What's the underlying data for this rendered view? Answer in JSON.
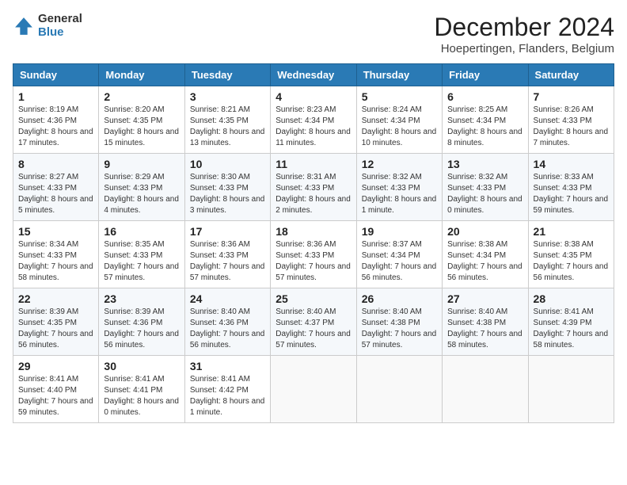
{
  "logo": {
    "general": "General",
    "blue": "Blue"
  },
  "title": "December 2024",
  "location": "Hoepertingen, Flanders, Belgium",
  "days_of_week": [
    "Sunday",
    "Monday",
    "Tuesday",
    "Wednesday",
    "Thursday",
    "Friday",
    "Saturday"
  ],
  "weeks": [
    [
      {
        "day": "1",
        "sunrise": "Sunrise: 8:19 AM",
        "sunset": "Sunset: 4:36 PM",
        "daylight": "Daylight: 8 hours and 17 minutes."
      },
      {
        "day": "2",
        "sunrise": "Sunrise: 8:20 AM",
        "sunset": "Sunset: 4:35 PM",
        "daylight": "Daylight: 8 hours and 15 minutes."
      },
      {
        "day": "3",
        "sunrise": "Sunrise: 8:21 AM",
        "sunset": "Sunset: 4:35 PM",
        "daylight": "Daylight: 8 hours and 13 minutes."
      },
      {
        "day": "4",
        "sunrise": "Sunrise: 8:23 AM",
        "sunset": "Sunset: 4:34 PM",
        "daylight": "Daylight: 8 hours and 11 minutes."
      },
      {
        "day": "5",
        "sunrise": "Sunrise: 8:24 AM",
        "sunset": "Sunset: 4:34 PM",
        "daylight": "Daylight: 8 hours and 10 minutes."
      },
      {
        "day": "6",
        "sunrise": "Sunrise: 8:25 AM",
        "sunset": "Sunset: 4:34 PM",
        "daylight": "Daylight: 8 hours and 8 minutes."
      },
      {
        "day": "7",
        "sunrise": "Sunrise: 8:26 AM",
        "sunset": "Sunset: 4:33 PM",
        "daylight": "Daylight: 8 hours and 7 minutes."
      }
    ],
    [
      {
        "day": "8",
        "sunrise": "Sunrise: 8:27 AM",
        "sunset": "Sunset: 4:33 PM",
        "daylight": "Daylight: 8 hours and 5 minutes."
      },
      {
        "day": "9",
        "sunrise": "Sunrise: 8:29 AM",
        "sunset": "Sunset: 4:33 PM",
        "daylight": "Daylight: 8 hours and 4 minutes."
      },
      {
        "day": "10",
        "sunrise": "Sunrise: 8:30 AM",
        "sunset": "Sunset: 4:33 PM",
        "daylight": "Daylight: 8 hours and 3 minutes."
      },
      {
        "day": "11",
        "sunrise": "Sunrise: 8:31 AM",
        "sunset": "Sunset: 4:33 PM",
        "daylight": "Daylight: 8 hours and 2 minutes."
      },
      {
        "day": "12",
        "sunrise": "Sunrise: 8:32 AM",
        "sunset": "Sunset: 4:33 PM",
        "daylight": "Daylight: 8 hours and 1 minute."
      },
      {
        "day": "13",
        "sunrise": "Sunrise: 8:32 AM",
        "sunset": "Sunset: 4:33 PM",
        "daylight": "Daylight: 8 hours and 0 minutes."
      },
      {
        "day": "14",
        "sunrise": "Sunrise: 8:33 AM",
        "sunset": "Sunset: 4:33 PM",
        "daylight": "Daylight: 7 hours and 59 minutes."
      }
    ],
    [
      {
        "day": "15",
        "sunrise": "Sunrise: 8:34 AM",
        "sunset": "Sunset: 4:33 PM",
        "daylight": "Daylight: 7 hours and 58 minutes."
      },
      {
        "day": "16",
        "sunrise": "Sunrise: 8:35 AM",
        "sunset": "Sunset: 4:33 PM",
        "daylight": "Daylight: 7 hours and 57 minutes."
      },
      {
        "day": "17",
        "sunrise": "Sunrise: 8:36 AM",
        "sunset": "Sunset: 4:33 PM",
        "daylight": "Daylight: 7 hours and 57 minutes."
      },
      {
        "day": "18",
        "sunrise": "Sunrise: 8:36 AM",
        "sunset": "Sunset: 4:33 PM",
        "daylight": "Daylight: 7 hours and 57 minutes."
      },
      {
        "day": "19",
        "sunrise": "Sunrise: 8:37 AM",
        "sunset": "Sunset: 4:34 PM",
        "daylight": "Daylight: 7 hours and 56 minutes."
      },
      {
        "day": "20",
        "sunrise": "Sunrise: 8:38 AM",
        "sunset": "Sunset: 4:34 PM",
        "daylight": "Daylight: 7 hours and 56 minutes."
      },
      {
        "day": "21",
        "sunrise": "Sunrise: 8:38 AM",
        "sunset": "Sunset: 4:35 PM",
        "daylight": "Daylight: 7 hours and 56 minutes."
      }
    ],
    [
      {
        "day": "22",
        "sunrise": "Sunrise: 8:39 AM",
        "sunset": "Sunset: 4:35 PM",
        "daylight": "Daylight: 7 hours and 56 minutes."
      },
      {
        "day": "23",
        "sunrise": "Sunrise: 8:39 AM",
        "sunset": "Sunset: 4:36 PM",
        "daylight": "Daylight: 7 hours and 56 minutes."
      },
      {
        "day": "24",
        "sunrise": "Sunrise: 8:40 AM",
        "sunset": "Sunset: 4:36 PM",
        "daylight": "Daylight: 7 hours and 56 minutes."
      },
      {
        "day": "25",
        "sunrise": "Sunrise: 8:40 AM",
        "sunset": "Sunset: 4:37 PM",
        "daylight": "Daylight: 7 hours and 57 minutes."
      },
      {
        "day": "26",
        "sunrise": "Sunrise: 8:40 AM",
        "sunset": "Sunset: 4:38 PM",
        "daylight": "Daylight: 7 hours and 57 minutes."
      },
      {
        "day": "27",
        "sunrise": "Sunrise: 8:40 AM",
        "sunset": "Sunset: 4:38 PM",
        "daylight": "Daylight: 7 hours and 58 minutes."
      },
      {
        "day": "28",
        "sunrise": "Sunrise: 8:41 AM",
        "sunset": "Sunset: 4:39 PM",
        "daylight": "Daylight: 7 hours and 58 minutes."
      }
    ],
    [
      {
        "day": "29",
        "sunrise": "Sunrise: 8:41 AM",
        "sunset": "Sunset: 4:40 PM",
        "daylight": "Daylight: 7 hours and 59 minutes."
      },
      {
        "day": "30",
        "sunrise": "Sunrise: 8:41 AM",
        "sunset": "Sunset: 4:41 PM",
        "daylight": "Daylight: 8 hours and 0 minutes."
      },
      {
        "day": "31",
        "sunrise": "Sunrise: 8:41 AM",
        "sunset": "Sunset: 4:42 PM",
        "daylight": "Daylight: 8 hours and 1 minute."
      },
      null,
      null,
      null,
      null
    ]
  ]
}
